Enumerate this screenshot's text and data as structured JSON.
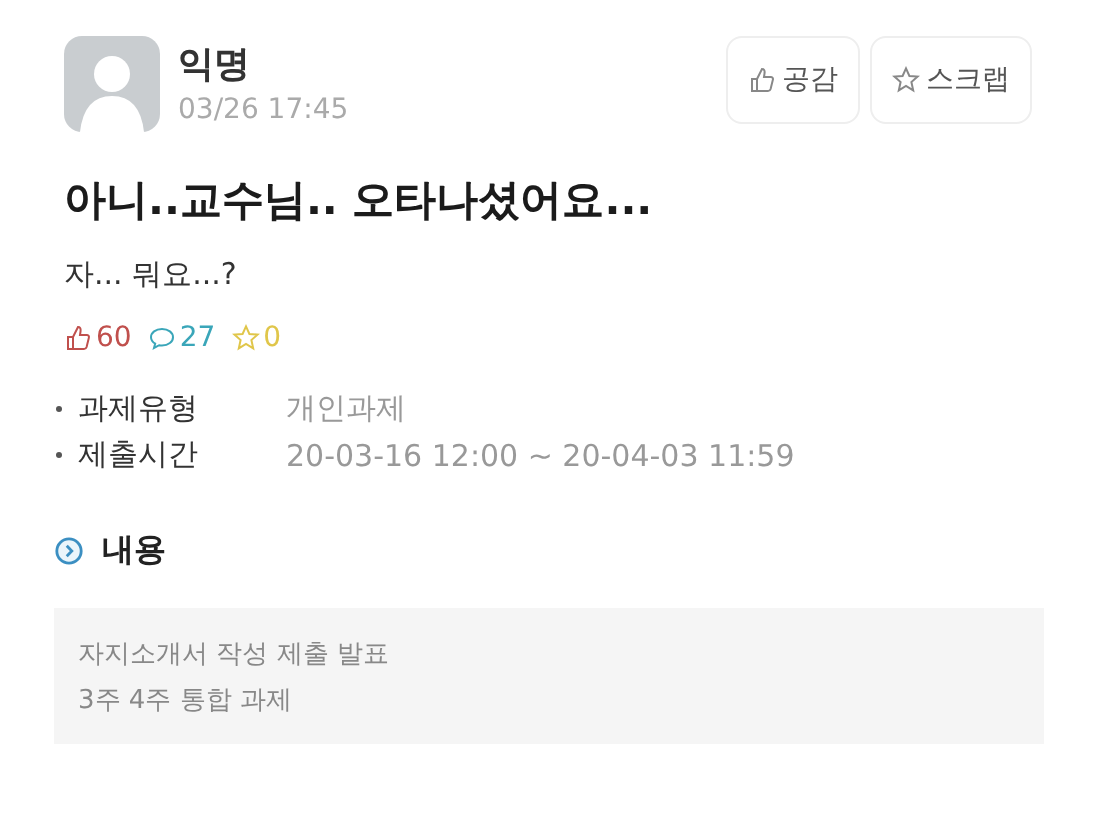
{
  "post": {
    "author": "익명",
    "time": "03/26 17:45",
    "title": "아니..교수님.. 오타나셨어요...",
    "body": "자... 뭐요...?"
  },
  "actions": [
    {
      "kind": "like",
      "label": "공감"
    },
    {
      "kind": "scrap",
      "label": "스크랩"
    }
  ],
  "stats": [
    {
      "kind": "like",
      "count": "60",
      "color": "#c0504d"
    },
    {
      "kind": "comment",
      "count": "27",
      "color": "#3aa6b9"
    },
    {
      "kind": "scrap",
      "count": "0",
      "color": "#e0c64a"
    }
  ],
  "info": [
    {
      "label": "과제유형",
      "value": "개인과제"
    },
    {
      "label": "제출시간",
      "value": "20-03-16 12:00 ~ 20-04-03 11:59"
    }
  ],
  "content": {
    "heading": "내용",
    "lines": [
      "자지소개서 작성 제출 발표",
      "3주 4주 통합 과제"
    ]
  }
}
